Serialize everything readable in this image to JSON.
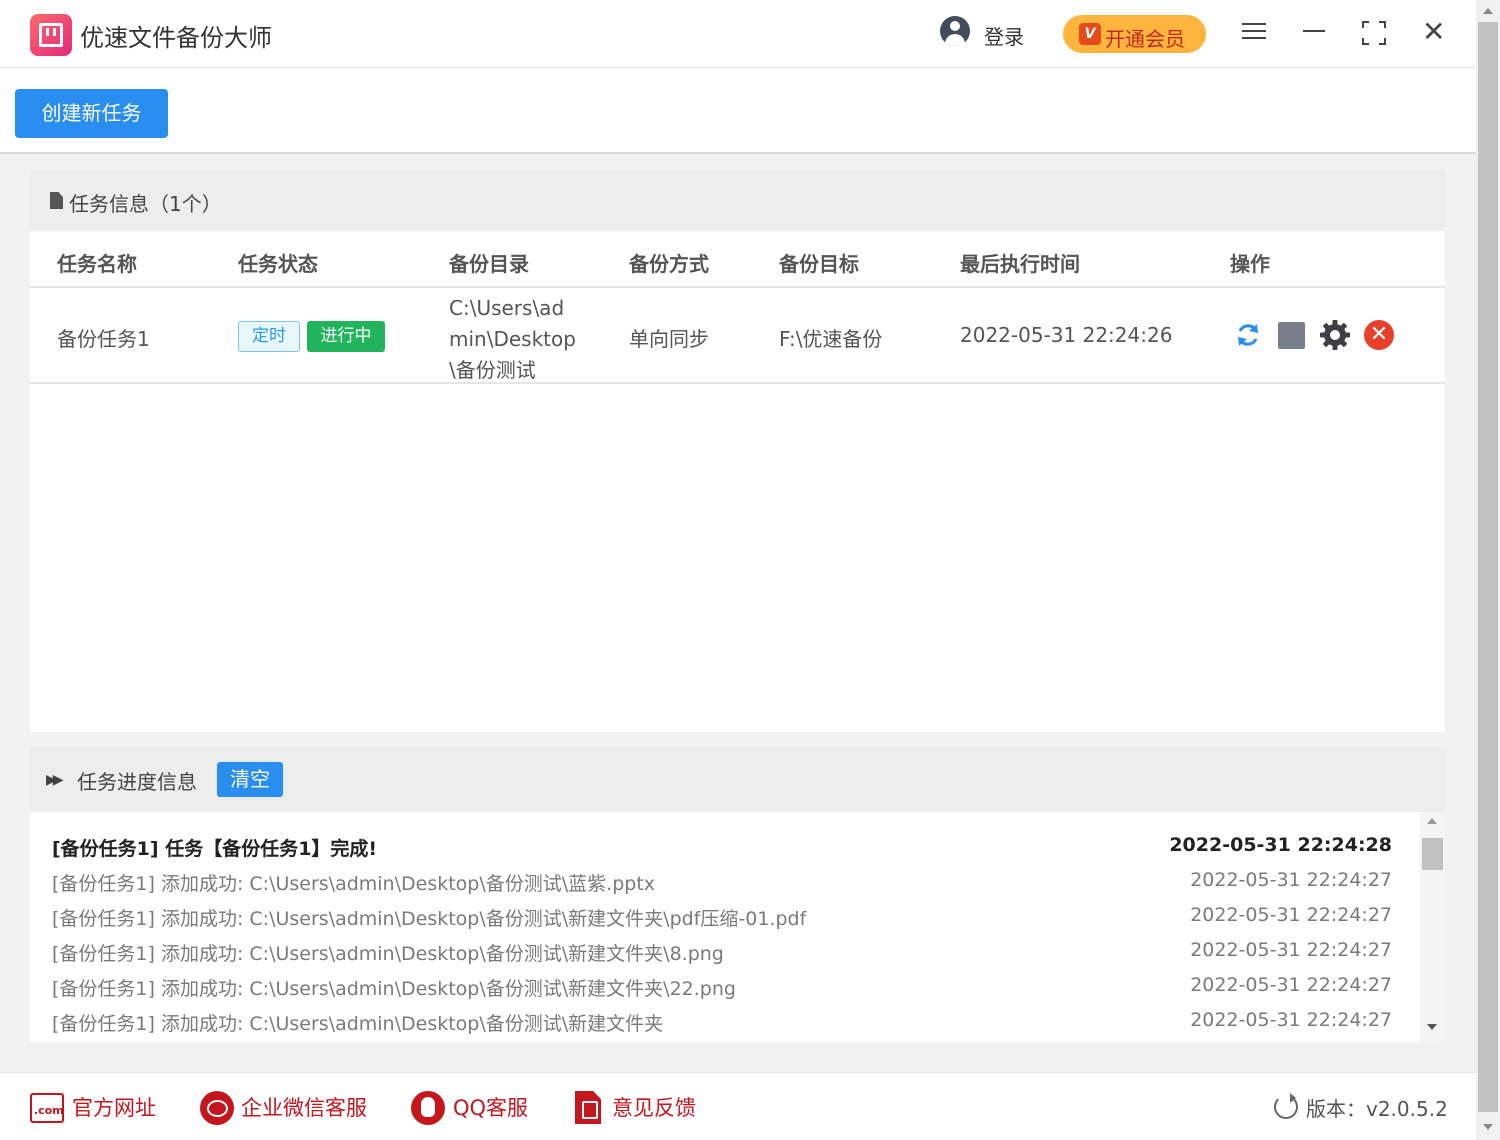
{
  "app": {
    "title": "优速文件备份大师",
    "login": "登录",
    "vip": "开通会员",
    "vip_icon_letter": "V"
  },
  "toolbar": {
    "create_label": "创建新任务"
  },
  "task_panel": {
    "title": "任务信息（1个）",
    "columns": [
      "任务名称",
      "任务状态",
      "备份目录",
      "备份方式",
      "备份目标",
      "最后执行时间",
      "操作"
    ],
    "rows": [
      {
        "name": "备份任务1",
        "tag_timer": "定时",
        "tag_status": "进行中",
        "source_dir": "C:\\Users\\admin\\Desktop\\备份测试",
        "method": "单向同步",
        "target": "F:\\优速备份",
        "last_run": "2022-05-31 22:24:26"
      }
    ]
  },
  "progress_panel": {
    "title": "任务进度信息",
    "clear_label": "清空",
    "logs": [
      {
        "msg": "[备份任务1] 任务【备份任务1】完成!",
        "time": "2022-05-31 22:24:28",
        "bold": true
      },
      {
        "msg": "[备份任务1] 添加成功:   C:\\Users\\admin\\Desktop\\备份测试\\蓝紫.pptx",
        "time": "2022-05-31 22:24:27"
      },
      {
        "msg": "[备份任务1] 添加成功:   C:\\Users\\admin\\Desktop\\备份测试\\新建文件夹\\pdf压缩-01.pdf",
        "time": "2022-05-31 22:24:27"
      },
      {
        "msg": "[备份任务1] 添加成功:   C:\\Users\\admin\\Desktop\\备份测试\\新建文件夹\\8.png",
        "time": "2022-05-31 22:24:27"
      },
      {
        "msg": "[备份任务1] 添加成功:   C:\\Users\\admin\\Desktop\\备份测试\\新建文件夹\\22.png",
        "time": "2022-05-31 22:24:27"
      },
      {
        "msg": "[备份任务1] 添加成功:   C:\\Users\\admin\\Desktop\\备份测试\\新建文件夹",
        "time": "2022-05-31 22:24:27"
      }
    ]
  },
  "footer": {
    "links": [
      "官方网址",
      "企业微信客服",
      "QQ客服",
      "意见反馈"
    ],
    "com_icon_text": ".com",
    "version": "版本：v2.0.5.2"
  },
  "colors": {
    "accent": "#2a8ef0",
    "vip": "#ffb53d",
    "running": "#22b35d",
    "danger": "#e8402b",
    "footer_link": "#c4161c"
  },
  "icons": [
    "app-logo-icon",
    "user-icon",
    "vip-icon",
    "menu-icon",
    "minimize-icon",
    "maximize-icon",
    "close-icon",
    "document-icon",
    "sync-icon",
    "stop-icon",
    "settings-icon",
    "delete-icon",
    "fast-forward-icon",
    "website-icon",
    "wechat-icon",
    "qq-icon",
    "pdf-icon",
    "refresh-icon"
  ]
}
